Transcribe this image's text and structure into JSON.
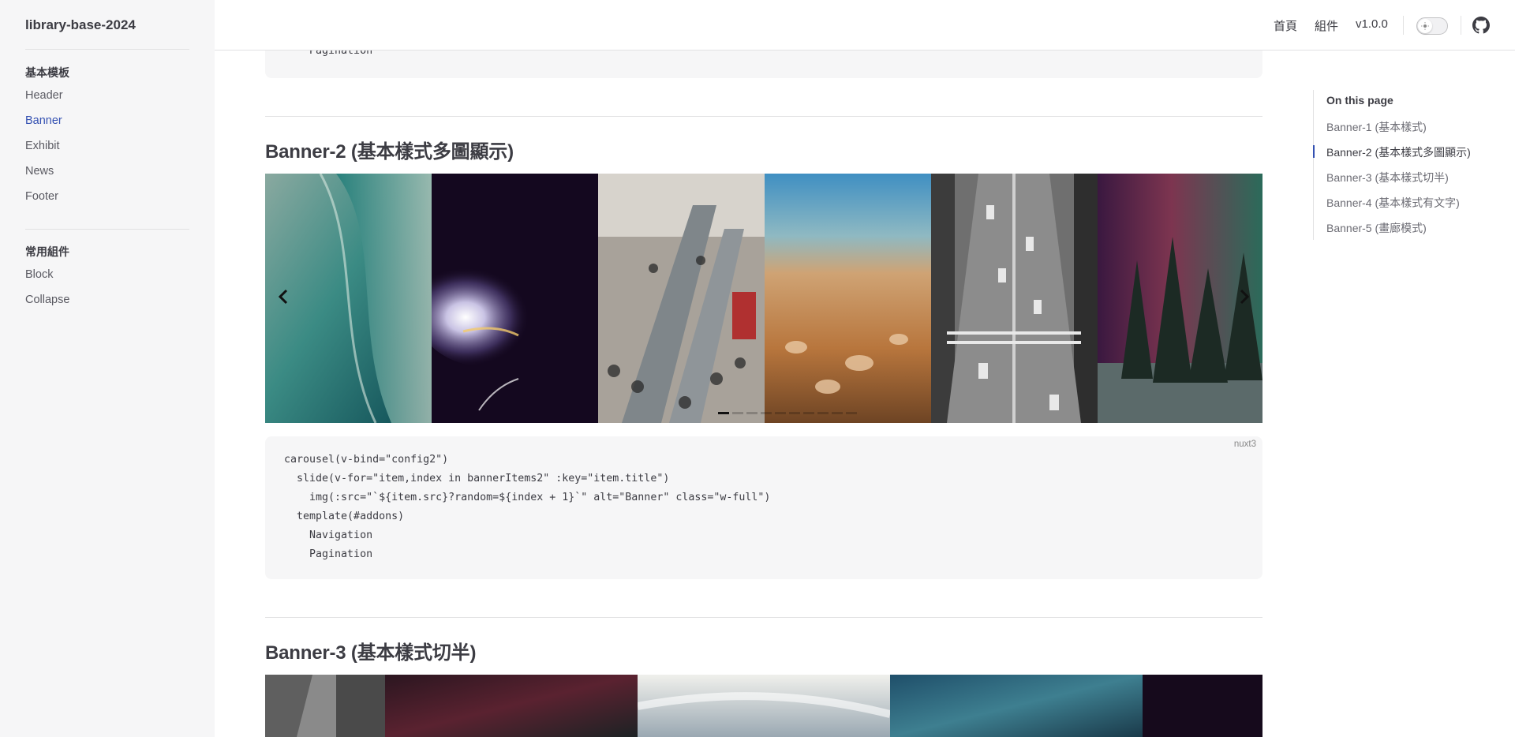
{
  "app": {
    "brand": "library-base-2024"
  },
  "sidebar": {
    "groups": [
      {
        "title": "基本模板",
        "items": [
          {
            "label": "Header"
          },
          {
            "label": "Banner"
          },
          {
            "label": "Exhibit"
          },
          {
            "label": "News"
          },
          {
            "label": "Footer"
          }
        ]
      },
      {
        "title": "常用組件",
        "items": [
          {
            "label": "Block"
          },
          {
            "label": "Collapse"
          }
        ]
      }
    ],
    "active_item": "Banner"
  },
  "topnav": {
    "links": [
      {
        "label": "首頁"
      },
      {
        "label": "組件"
      },
      {
        "label": "v1.0.0"
      }
    ],
    "theme_toggle_icon": "sun-icon",
    "github_icon": "github-icon"
  },
  "content": {
    "top_code_tail": "    Pagination",
    "sections": [
      {
        "title": "Banner-2 (基本樣式多圖顯示)"
      },
      {
        "title": "Banner-3 (基本樣式切半)"
      }
    ],
    "code": {
      "lang": "nuxt3",
      "lines": [
        "carousel(v-bind=\"config2\")",
        "  slide(v-for=\"item,index in bannerItems2\" :key=\"item.title\")",
        "    img(:src=\"`${item.src}?random=${index + 1}`\" alt=\"Banner\" class=\"w-full\")",
        "  template(#addons)",
        "    Navigation",
        "    Pagination"
      ]
    },
    "carousel": {
      "slides": [
        {
          "subject": "ocean-wave"
        },
        {
          "subject": "smoke-on-dark"
        },
        {
          "subject": "crowded-escalator"
        },
        {
          "subject": "beach-shells"
        },
        {
          "subject": "city-street-bw"
        },
        {
          "subject": "aurora-forest"
        }
      ],
      "prev_icon": "chevron-left-icon",
      "next_icon": "chevron-right-icon",
      "pagination_count": 10,
      "active_dot": 0
    }
  },
  "toc": {
    "title": "On this page",
    "items": [
      {
        "label": "Banner-1 (基本樣式)"
      },
      {
        "label": "Banner-2 (基本樣式多圖顯示)"
      },
      {
        "label": "Banner-3 (基本樣式切半)"
      },
      {
        "label": "Banner-4 (基本樣式有文字)"
      },
      {
        "label": "Banner-5 (畫廊模式)"
      }
    ],
    "active_index": 1
  },
  "colors": {
    "accent": "#3451b2",
    "sidebar_bg": "#f6f6f7",
    "code_bg": "#f6f6f7"
  }
}
